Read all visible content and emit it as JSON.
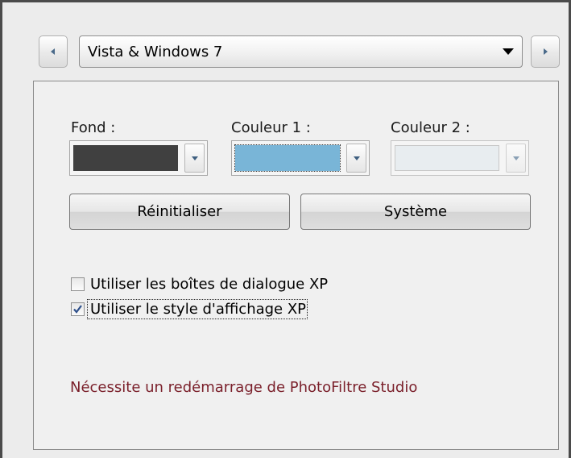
{
  "theme_selector": {
    "selected": "Vista & Windows 7",
    "prev_icon": "arrow-left-small-icon",
    "next_icon": "arrow-right-small-icon",
    "dropdown_icon": "chevron-down-icon"
  },
  "colors": {
    "fond": {
      "label": "Fond :",
      "value": "#404040",
      "enabled": true
    },
    "couleur1": {
      "label": "Couleur 1 :",
      "value": "#79b5d7",
      "enabled": true
    },
    "couleur2": {
      "label": "Couleur 2 :",
      "value": "#e8edf0",
      "enabled": false
    }
  },
  "buttons": {
    "reset_label": "Réinitialiser",
    "system_label": "Système"
  },
  "options": {
    "xp_dialogs": {
      "label": "Utiliser les boîtes de dialogue XP",
      "checked": false
    },
    "xp_style": {
      "label": "Utiliser le style d'affichage XP",
      "checked": true
    }
  },
  "note": "Nécessite un redémarrage de PhotoFiltre Studio"
}
